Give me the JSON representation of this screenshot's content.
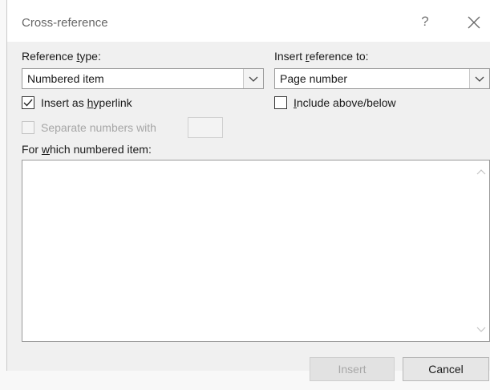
{
  "dialog": {
    "title": "Cross-reference",
    "help_glyph": "?",
    "close_glyph": "×"
  },
  "reference_type": {
    "label_pre": "Reference ",
    "label_u": "t",
    "label_post": "ype:",
    "value": "Numbered item"
  },
  "insert_reference": {
    "label_pre": "Insert ",
    "label_u": "r",
    "label_post": "eference to:",
    "value": "Page number"
  },
  "options": {
    "hyperlink_pre": "Insert as ",
    "hyperlink_u": "h",
    "hyperlink_post": "yperlink",
    "hyperlink_checked": true,
    "include_pre": "",
    "include_u": "I",
    "include_post": "nclude above/below",
    "include_checked": false,
    "separate_label": "Separate numbers with",
    "separate_checked": false,
    "separate_value": ""
  },
  "which": {
    "label_pre": "For ",
    "label_u": "w",
    "label_post": "hich numbered item:",
    "items": []
  },
  "buttons": {
    "insert": "Insert",
    "cancel": "Cancel"
  }
}
